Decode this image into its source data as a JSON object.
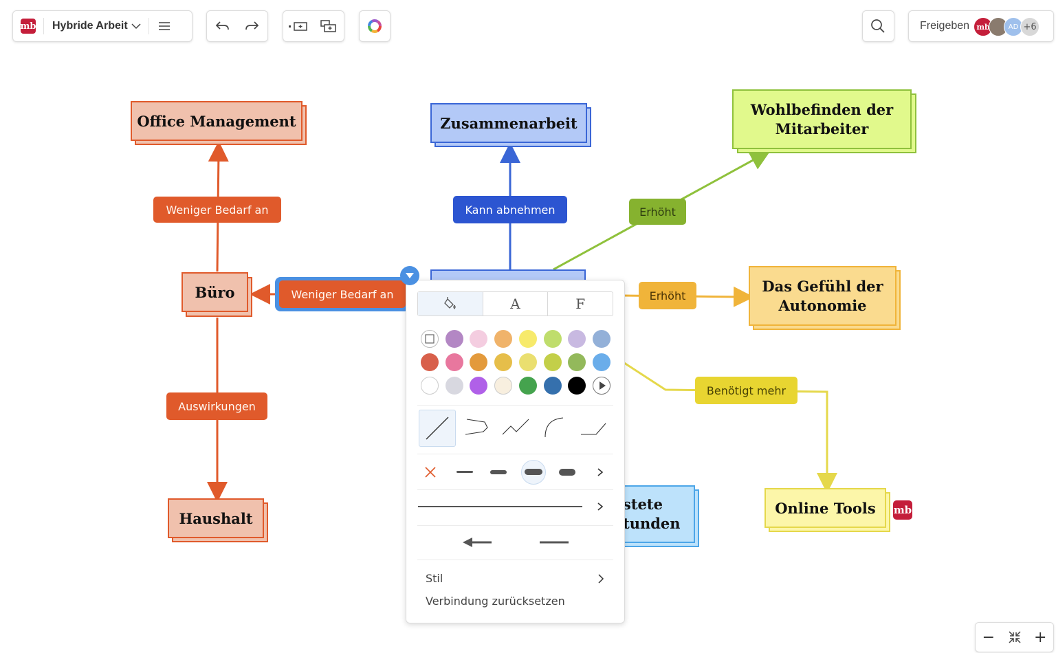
{
  "toolbar": {
    "logo_text": "mb",
    "map_title": "Hybride Arbeit",
    "share_label": "Freigeben",
    "avatar_initials": "AD",
    "avatar_more": "+6"
  },
  "nodes": {
    "office": "Office Management",
    "zusammenarbeit": "Zusammenarbeit",
    "wohlbefinden": "Wohlbefinden der Mitarbeiter",
    "gefuehl": "Das Gefühl der Autonomie",
    "buero": "Büro",
    "haushalt": "Haushalt",
    "online": "Online Tools",
    "stunden_partial": "stete\ntunden"
  },
  "labels": {
    "weniger1": "Weniger Bedarf an",
    "weniger2": "Weniger Bedarf an",
    "auswirkungen": "Auswirkungen",
    "kann": "Kann abnehmen",
    "erhoeht1": "Erhöht",
    "erhoeht2": "Erhöht",
    "benoetigt": "Benötigt mehr"
  },
  "panel": {
    "tabs": [
      "A",
      "F"
    ],
    "stil_label": "Stil",
    "reset_label": "Verbindung zurücksetzen"
  },
  "colors": {
    "orange_node_fill": "#f0c1ad",
    "orange_node_border": "#e05a2b",
    "blue_node_fill": "#b3c9f7",
    "blue_node_border": "#3a66d6",
    "green_node_fill": "#e1f98c",
    "green_node_border": "#8fc13c",
    "yellow_node_fill": "#fadb8f",
    "yellow_node_border": "#f0b43a",
    "lightyellow_node_fill": "#fcf6a9",
    "lightyellow_node_border": "#e5d84b",
    "lightblue_node_fill": "#bde2fb",
    "lightblue_node_border": "#4da6e8",
    "swatches": [
      [
        "none",
        "#b387c4",
        "#f4cde0",
        "#f0b36a",
        "#f7ea6b",
        "#bfdd6c",
        "#c8b9e1",
        "#93b0d8"
      ],
      [
        "#d8604b",
        "#e8779e",
        "#e39a3c",
        "#e6be4a",
        "#eadf70",
        "#c3cf49",
        "#93b95b",
        "#6aadea"
      ],
      [
        "#ffffff",
        "#d8d8e0",
        "#b060e8",
        "#f8efdf",
        "#45a34e",
        "#3570ad",
        "#000000",
        "more"
      ]
    ]
  },
  "zoom_controls": {
    "minus": "−",
    "plus": "+"
  }
}
